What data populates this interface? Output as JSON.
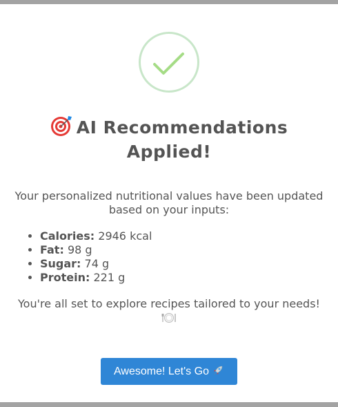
{
  "dialog": {
    "title_line1": "AI Recommendations",
    "title_line2": "Applied!",
    "title_icon": "direct-hit-target-icon",
    "intro_text": "Your personalized nutritional values have been updated based on your inputs:",
    "nutrients": [
      {
        "label": "Calories:",
        "value": "2946 kcal"
      },
      {
        "label": "Fat:",
        "value": "98 g"
      },
      {
        "label": "Sugar:",
        "value": "74 g"
      },
      {
        "label": "Protein:",
        "value": "221 g"
      }
    ],
    "closing_text": "You're all set to explore recipes tailored to your needs!",
    "closing_icon": "plate-icon",
    "confirm_label": "Awesome! Let's Go",
    "confirm_icon": "rocket-icon"
  },
  "colors": {
    "success_ring": "#c8e6c9",
    "success_check": "#a5dc86",
    "button_bg": "#2f86d6",
    "text": "#545454",
    "frame_bar": "#a3a3a3"
  }
}
